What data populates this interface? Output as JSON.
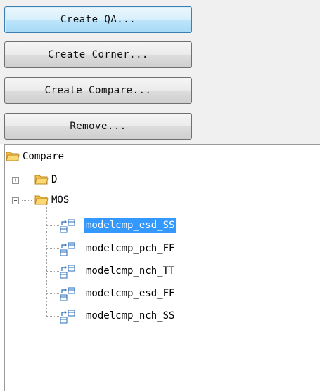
{
  "buttons": {
    "create_qa": "Create QA...",
    "create_corner": "Create Corner...",
    "create_compare": "Create Compare...",
    "remove": "Remove..."
  },
  "tree": {
    "root_label": "Compare",
    "folders": [
      {
        "label": "D",
        "expanded": false
      },
      {
        "label": "MOS",
        "expanded": true
      }
    ],
    "items": [
      {
        "label": "modelcmp_esd_SS",
        "selected": true
      },
      {
        "label": "modelcmp_pch_FF",
        "selected": false
      },
      {
        "label": "modelcmp_nch_TT",
        "selected": false
      },
      {
        "label": "modelcmp_esd_FF",
        "selected": false
      },
      {
        "label": "modelcmp_nch_SS",
        "selected": false
      }
    ],
    "expand_symbol": "+",
    "collapse_symbol": "−"
  },
  "colors": {
    "selection": "#3399ff",
    "folder": "#f5c242"
  },
  "icons": {
    "folder": "folder-icon",
    "compare_item": "compare-item-icon"
  }
}
